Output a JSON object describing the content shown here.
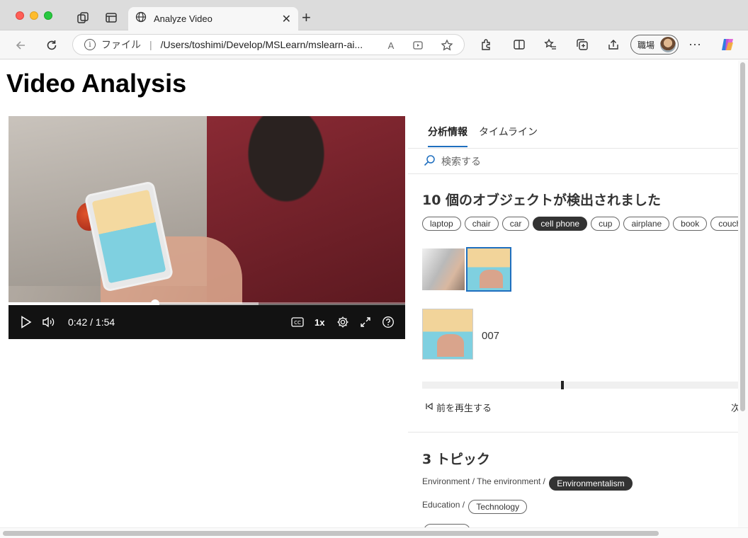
{
  "browser": {
    "tab_title": "Analyze Video",
    "address_file_label": "ファイル",
    "address_separator": "|",
    "address_url": "/Users/toshimi/Develop/MSLearn/mslearn-ai...",
    "profile_label": "職場"
  },
  "page": {
    "title": "Video Analysis"
  },
  "player": {
    "time_display": "0:42 / 1:54",
    "playback_rate": "1x",
    "progress_fraction": 0.37,
    "buffered_fraction": 0.63,
    "captions_label": "CC"
  },
  "panel": {
    "tabs": [
      {
        "label": "分析情報",
        "active": true
      },
      {
        "label": "タイムライン",
        "active": false
      }
    ],
    "search_placeholder": "検索する",
    "objects": {
      "title": "10 個のオブジェクトが検出されました",
      "chips": [
        "laptop",
        "chair",
        "car",
        "cell phone",
        "cup",
        "airplane",
        "book",
        "couch"
      ],
      "selected_chip": "cell phone",
      "instance_id": "007",
      "prev_label": "前を再生する",
      "next_label_fragment": "次"
    },
    "topics": {
      "title": "3 トピック",
      "rows": [
        {
          "path": "Environment / The environment / ",
          "tag": "Environmentalism",
          "selected": true
        },
        {
          "path": "Education / ",
          "tag": "Technology",
          "selected": false
        }
      ]
    }
  }
}
